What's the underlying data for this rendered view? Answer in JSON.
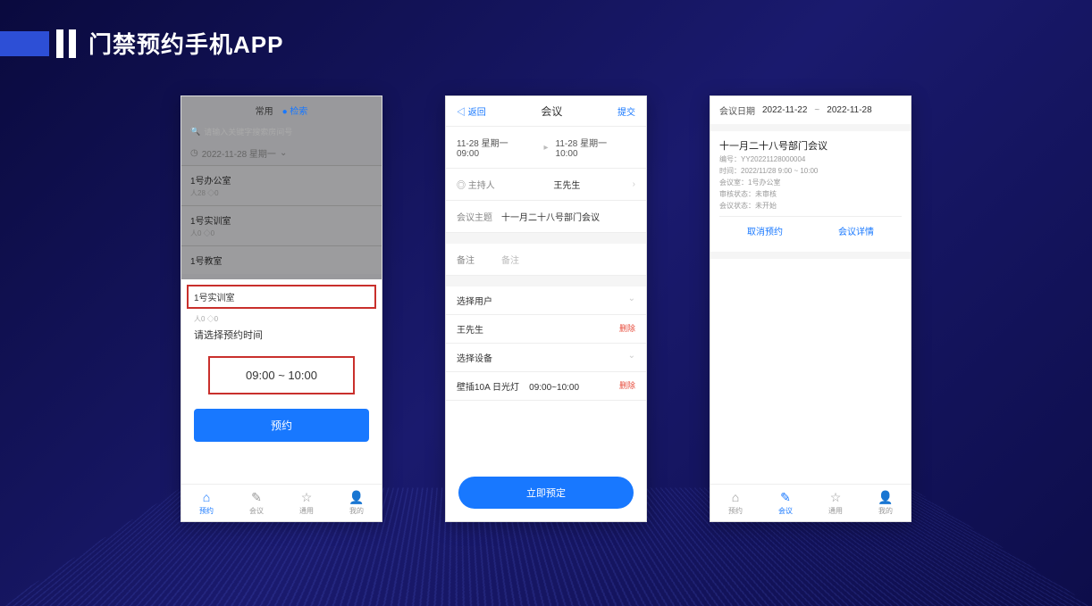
{
  "page_title": "门禁预约手机APP",
  "phone1": {
    "tab_common": "常用",
    "tab_search": "● 检索",
    "search_placeholder": "请输入关键字搜索房间号",
    "date": "2022-11-28 星期一",
    "rooms": [
      {
        "name": "1号办公室",
        "meta": "人28  ◇0"
      },
      {
        "name": "1号实训室",
        "meta": "人0  ◇0"
      },
      {
        "name": "1号教室",
        "meta": ""
      }
    ],
    "selected_room": "1号实训室",
    "selected_meta": "人0  ◇0",
    "time_prompt": "请选择预约时间",
    "time_range": "09:00 ~ 10:00",
    "book_btn": "预约"
  },
  "phone2": {
    "back": "◁ 返回",
    "title": "会议",
    "submit": "提交",
    "start_date": "11-28 星期一",
    "start_time": "09:00",
    "end_date": "11-28 星期一",
    "end_time": "10:00",
    "host_label": "◎ 主持人",
    "host_value": "王先生",
    "subject_label": "会议主题",
    "subject_value": "十一月二十八号部门会议",
    "remark_label": "备注",
    "remark_value": "备注",
    "user_section": "选择用户",
    "user1": "王先生",
    "device_section": "选择设备",
    "device1_name": "壁插10A 日光灯",
    "device1_time": "09:00~10:00",
    "delete": "删除",
    "book_btn": "立即预定"
  },
  "phone3": {
    "dr_label": "会议日期",
    "dr_start": "2022-11-22",
    "dr_end": "2022-11-28",
    "meeting_title": "十一月二十八号部门会议",
    "meta_id": "编号：YY20221128000004",
    "meta_time": "时间：2022/11/28 9:00 ~ 10:00",
    "meta_room": "会议室：1号办公室",
    "meta_approve": "审核状态：未审核",
    "meta_status": "会议状态：未开始",
    "action_cancel": "取消预约",
    "action_detail": "会议详情"
  },
  "tabbar": {
    "t1": "预约",
    "t2": "会议",
    "t3": "通用",
    "t4": "我的"
  }
}
